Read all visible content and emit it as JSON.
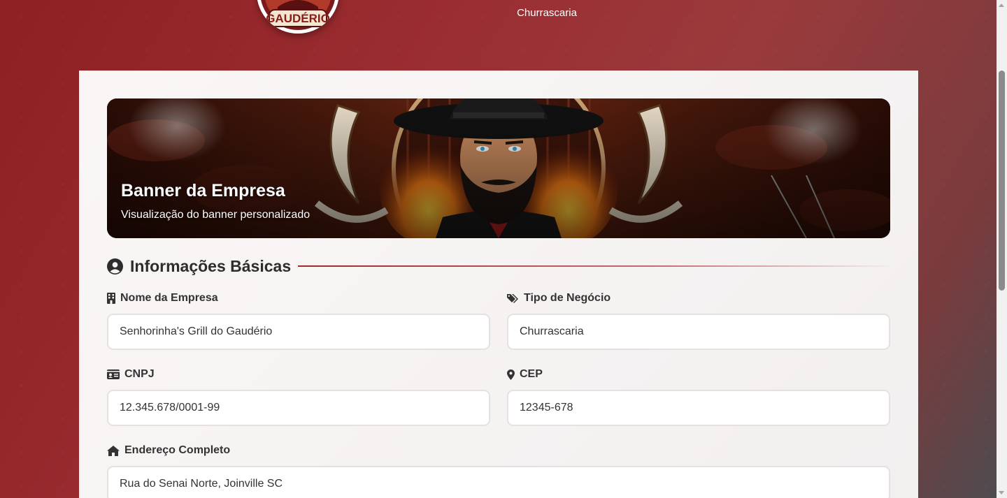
{
  "header": {
    "logo_text": "GAUDÉRIO",
    "subtitle": "Churrascaria"
  },
  "banner": {
    "title": "Banner da Empresa",
    "subtitle": "Visualização do banner personalizado"
  },
  "section": {
    "title": "Informações Básicas",
    "icon": "user-circle-icon"
  },
  "fields": {
    "company_name": {
      "label": "Nome da Empresa",
      "value": "Senhorinha's Grill do Gaudério",
      "icon": "building-icon"
    },
    "business_type": {
      "label": "Tipo de Negócio",
      "value": "Churrascaria",
      "icon": "tags-icon"
    },
    "cnpj": {
      "label": "CNPJ",
      "value": "12.345.678/0001-99",
      "icon": "id-card-icon"
    },
    "cep": {
      "label": "CEP",
      "value": "12345-678",
      "icon": "map-pin-icon"
    },
    "address": {
      "label": "Endereço Completo",
      "value": "Rua do Senai Norte, Joinville SC",
      "icon": "home-icon"
    }
  },
  "colors": {
    "brand_red": "#9a2d31",
    "accent_line": "#a3262b",
    "card_bg": "#f7f4f4"
  }
}
